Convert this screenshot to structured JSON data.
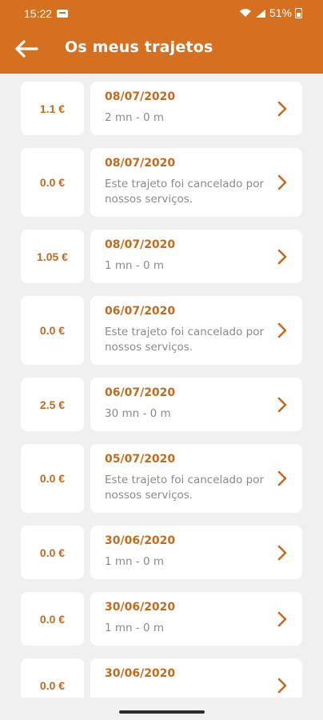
{
  "status_bar": {
    "time": "15:22",
    "battery": "51%"
  },
  "header": {
    "title": "Os meus trajetos",
    "back_icon": "arrow-left-icon"
  },
  "colors": {
    "accent": "#d4701f",
    "accent_text": "#c46a1d",
    "muted_text": "#8a8a8a",
    "background": "#f0f0f0"
  },
  "trips": [
    {
      "price": "1.1 €",
      "date": "08/07/2020",
      "info": "2 mn - 0 m"
    },
    {
      "price": "0.0 €",
      "date": "08/07/2020",
      "info": "Este trajeto foi cancelado por nossos serviços."
    },
    {
      "price": "1.05 €",
      "date": "08/07/2020",
      "info": "1 mn - 0 m"
    },
    {
      "price": "0.0 €",
      "date": "06/07/2020",
      "info": "Este trajeto foi cancelado por nossos serviços."
    },
    {
      "price": "2.5 €",
      "date": "06/07/2020",
      "info": "30 mn - 0 m"
    },
    {
      "price": "0.0 €",
      "date": "05/07/2020",
      "info": "Este trajeto foi cancelado por nossos serviços."
    },
    {
      "price": "0.0 €",
      "date": "30/06/2020",
      "info": "1 mn - 0 m"
    },
    {
      "price": "0.0 €",
      "date": "30/06/2020",
      "info": "1 mn - 0 m"
    },
    {
      "price": "0.0 €",
      "date": "30/06/2020",
      "info": ""
    }
  ]
}
